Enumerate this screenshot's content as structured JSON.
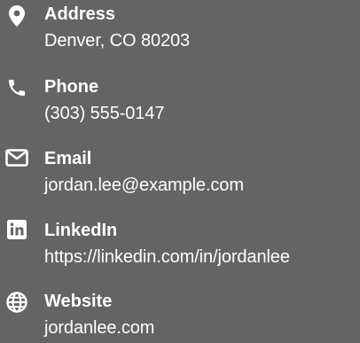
{
  "contact": {
    "items": [
      {
        "icon": "map-pin-icon",
        "label": "Address",
        "value": "Denver, CO 80203"
      },
      {
        "icon": "phone-icon",
        "label": "Phone",
        "value": "(303) 555-0147"
      },
      {
        "icon": "envelope-icon",
        "label": "Email",
        "value": "jordan.lee@example.com"
      },
      {
        "icon": "linkedin-icon",
        "label": "LinkedIn",
        "value": "https://linkedin.com/in/jordanlee"
      },
      {
        "icon": "globe-icon",
        "label": "Website",
        "value": "jordanlee.com"
      }
    ]
  },
  "colors": {
    "background": "#646464",
    "text": "#ffffff"
  }
}
